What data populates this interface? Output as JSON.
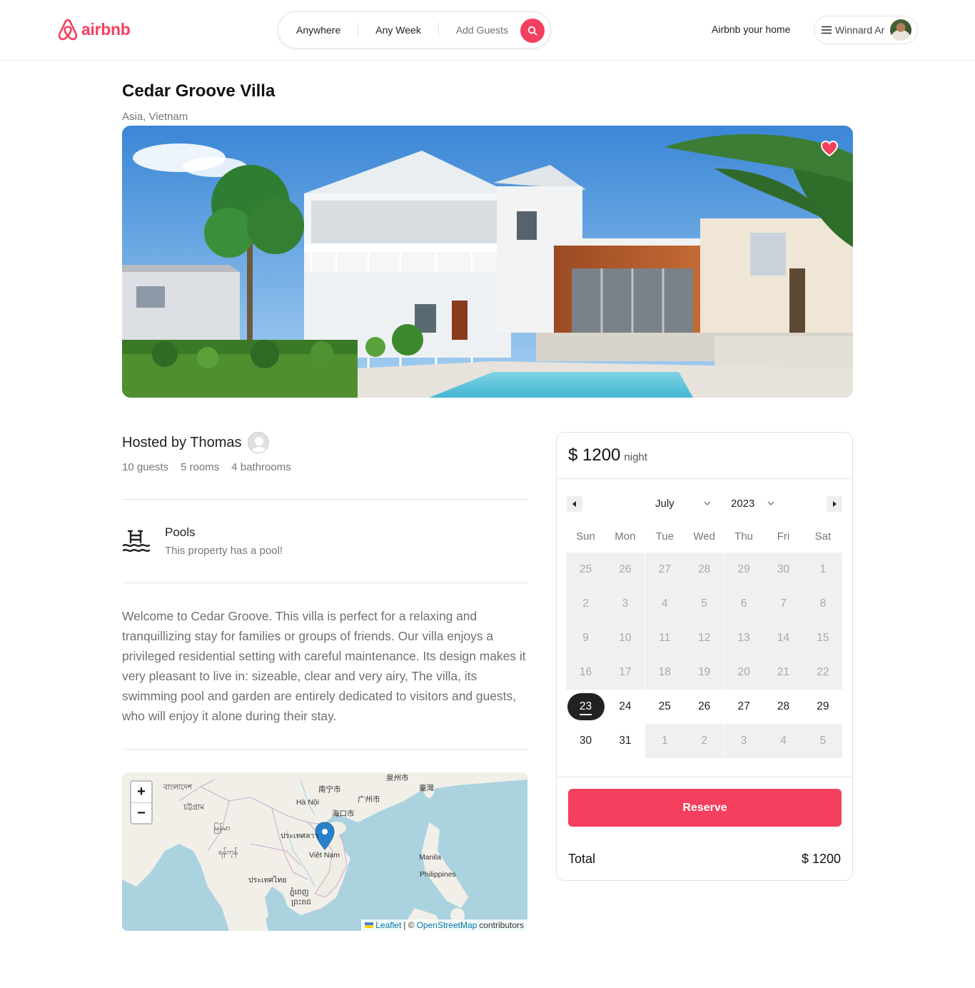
{
  "navbar": {
    "logo_text": "airbnb",
    "search": {
      "location": "Anywhere",
      "week": "Any Week",
      "guests": "Add Guests"
    },
    "host_link": "Airbnb your home",
    "user_name": "Winnard Ar"
  },
  "listing": {
    "title": "Cedar Groove Villa",
    "location": "Asia, Vietnam",
    "favorited": true,
    "host": "Hosted by Thomas",
    "specs": [
      "10 guests",
      "5 rooms",
      "4 bathrooms"
    ],
    "amenity": {
      "icon": "pool-icon",
      "title": "Pools",
      "description": "This property has a pool!"
    },
    "description": "Welcome to Cedar Groove. This villa is perfect for a relaxing and tranquillizing stay for families or groups of friends. Our villa enjoys a privileged residential setting with careful maintenance. Its design makes it very pleasant to live in: sizeable, clear and very airy, The villa, its swimming pool and garden are entirely dedicated to visitors and guests, who will enjoy it alone during their stay."
  },
  "map": {
    "zoom_in": "+",
    "zoom_out": "−",
    "labels": [
      "বাংলাদেশ",
      "চট্টগ্রাম",
      "南宁市",
      "Hà Nội",
      "广州市",
      "泉州市",
      "臺灣",
      "海口市",
      "မြန်မာ",
      "ประเทศลาว",
      "ရန်ကုန်",
      "Việt Nam",
      "Manila",
      "Philippines",
      "ประเทศไทย",
      "ភ្នំពេញ",
      "ព្រះរាជ"
    ],
    "attribution": {
      "leaflet": "Leaflet",
      "separator": "| ©",
      "osm": "OpenStreetMap",
      "suffix": "contributors"
    }
  },
  "booking": {
    "price": "$ 1200",
    "unit": "night",
    "calendar": {
      "month": "July",
      "year": "2023",
      "weekdays": [
        "Sun",
        "Mon",
        "Tue",
        "Wed",
        "Thu",
        "Fri",
        "Sat"
      ],
      "weeks": [
        [
          "25",
          "26",
          "27",
          "28",
          "29",
          "30",
          "1"
        ],
        [
          "2",
          "3",
          "4",
          "5",
          "6",
          "7",
          "8"
        ],
        [
          "9",
          "10",
          "11",
          "12",
          "13",
          "14",
          "15"
        ],
        [
          "16",
          "17",
          "18",
          "19",
          "20",
          "21",
          "22"
        ],
        [
          "23",
          "24",
          "25",
          "26",
          "27",
          "28",
          "29"
        ],
        [
          "30",
          "31",
          "1",
          "2",
          "3",
          "4",
          "5"
        ]
      ],
      "selected_day": "23"
    },
    "reserve_label": "Reserve",
    "total_label": "Total",
    "total_value": "$ 1200"
  },
  "colors": {
    "brand": "#f43f5e",
    "text": "#222222",
    "muted": "#777777"
  }
}
